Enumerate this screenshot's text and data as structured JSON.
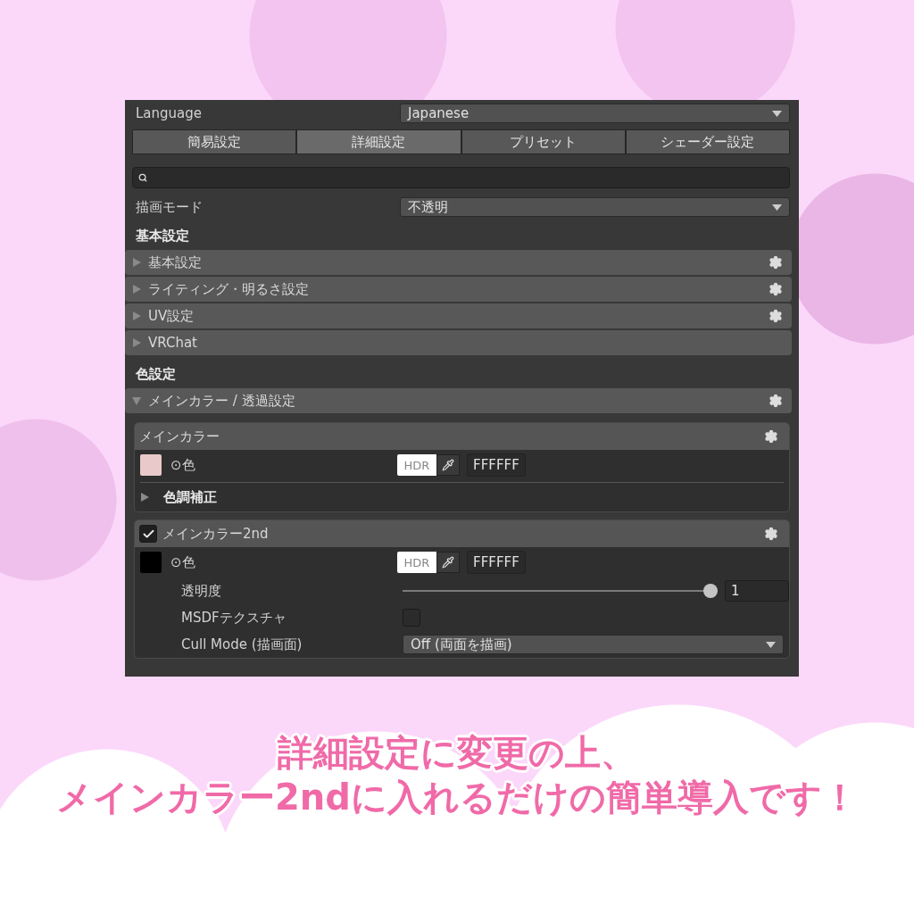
{
  "language": {
    "label": "Language",
    "value": "Japanese"
  },
  "tabs": [
    {
      "label": "簡易設定",
      "selected": false
    },
    {
      "label": "詳細設定",
      "selected": true
    },
    {
      "label": "プリセット",
      "selected": false
    },
    {
      "label": "シェーダー設定",
      "selected": false
    }
  ],
  "render_mode": {
    "label": "描画モード",
    "value": "不透明"
  },
  "groups": [
    {
      "heading": "基本設定",
      "foldouts": [
        {
          "label": "基本設定",
          "expanded": false,
          "gear": true
        },
        {
          "label": "ライティング・明るさ設定",
          "expanded": false,
          "gear": true
        },
        {
          "label": "UV設定",
          "expanded": false,
          "gear": true
        },
        {
          "label": "VRChat",
          "expanded": false,
          "gear": false
        }
      ]
    },
    {
      "heading": "色設定",
      "foldouts": [
        {
          "label": "メインカラー / 透過設定",
          "expanded": true,
          "gear": true
        }
      ]
    }
  ],
  "main_color": {
    "title": "メインカラー",
    "color_label": "⊙色",
    "hdr": "HDR",
    "hex": "FFFFFF",
    "sub_foldout": {
      "label": "色調補正",
      "expanded": false
    }
  },
  "main_color_2nd": {
    "title": "メインカラー2nd",
    "checked": true,
    "color_label": "⊙色",
    "hdr": "HDR",
    "hex": "FFFFFF",
    "opacity": {
      "label": "透明度",
      "level": 1,
      "value": "1"
    },
    "msdf": {
      "label": "MSDFテクスチャ",
      "checked": false
    },
    "cull_mode": {
      "label": "Cull Mode (描画面)",
      "value": "Off (両面を描画)"
    }
  },
  "caption": [
    "詳細設定に変更の上、",
    "メインカラー2ndに入れるだけの簡単導入です！"
  ]
}
